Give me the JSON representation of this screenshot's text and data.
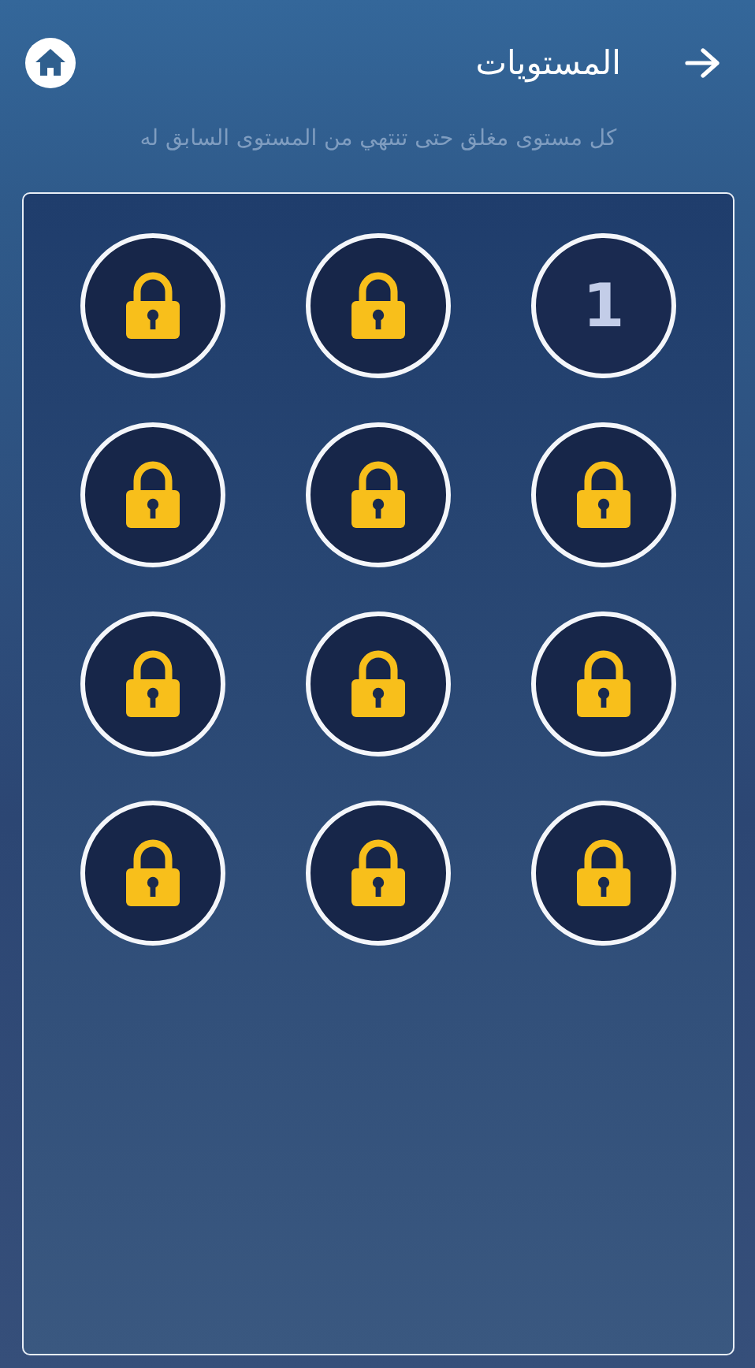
{
  "header": {
    "title": "المستويات"
  },
  "subtitle": "كل مستوى مغلق حتى تنتهي من المستوى السابق له",
  "levels": [
    {
      "locked": false,
      "number": "1"
    },
    {
      "locked": true
    },
    {
      "locked": true
    },
    {
      "locked": true
    },
    {
      "locked": true
    },
    {
      "locked": true
    },
    {
      "locked": true
    },
    {
      "locked": true
    },
    {
      "locked": true
    },
    {
      "locked": true
    },
    {
      "locked": true
    },
    {
      "locked": true
    }
  ]
}
